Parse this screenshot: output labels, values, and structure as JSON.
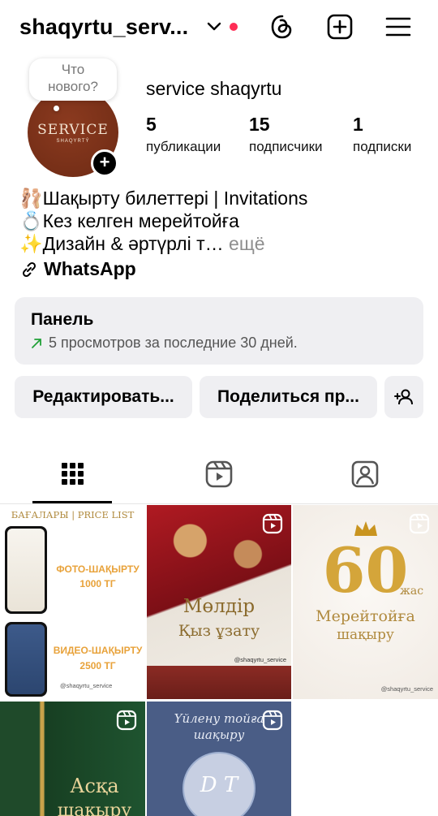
{
  "header": {
    "username": "shaqyrtu_serv...",
    "icons": [
      "chevron-down-icon",
      "threads-icon",
      "add-post-icon",
      "menu-icon"
    ],
    "notification_dot_color": "#ff2d55"
  },
  "profile": {
    "note_bubble": "Что\nнового?",
    "avatar_title": "SERVICE",
    "avatar_subtitle": "SHAQYRTÝ",
    "full_name": "service shaqyrtu",
    "stats": [
      {
        "value": "5",
        "label": "публикации"
      },
      {
        "value": "15",
        "label": "подписчики"
      },
      {
        "value": "1",
        "label": "подписки"
      }
    ],
    "bio": [
      "🩰Шақырту билеттері | Invitations",
      "💍Кез келген мерейтойға",
      "✨Дизайн & әртүрлі т…"
    ],
    "bio_more": "ещё",
    "link": "WhatsApp"
  },
  "panel": {
    "title": "Панель",
    "subtitle": "5 просмотров за последние 30 дней."
  },
  "buttons": {
    "edit": "Редактировать...",
    "share": "Поделиться пр...",
    "add_person_icon": "add-person-icon"
  },
  "tabs": [
    "grid-icon",
    "reels-icon",
    "tagged-icon"
  ],
  "posts": {
    "p1_heading": "БАҒАЛАРЫ | PRICE LIST",
    "p1_photo": "ФОТО-ШАҚЫРТУ",
    "p1_photo_price": "1000 ТГ",
    "p1_video": "ВИДЕО-ШАҚЫРТУ",
    "p1_video_price": "2500 ТГ",
    "p1_handle": "@shaqyrtu_service",
    "p2_line1": "Мөлдір",
    "p2_line2": "Қыз ұзату",
    "p2_handle": "@shaqyrtu_service",
    "p3_number": "60",
    "p3_suffix": "жас",
    "p3_line1": "Мерейтойға",
    "p3_line2": "шақыру",
    "p3_handle": "@shaqyrtu_service",
    "p4_line1": "Асқа",
    "p4_line2": "шақыру",
    "p5_line1": "Үйлену тойға",
    "p5_line2": "шақыру",
    "p5_monogram": "D T"
  }
}
